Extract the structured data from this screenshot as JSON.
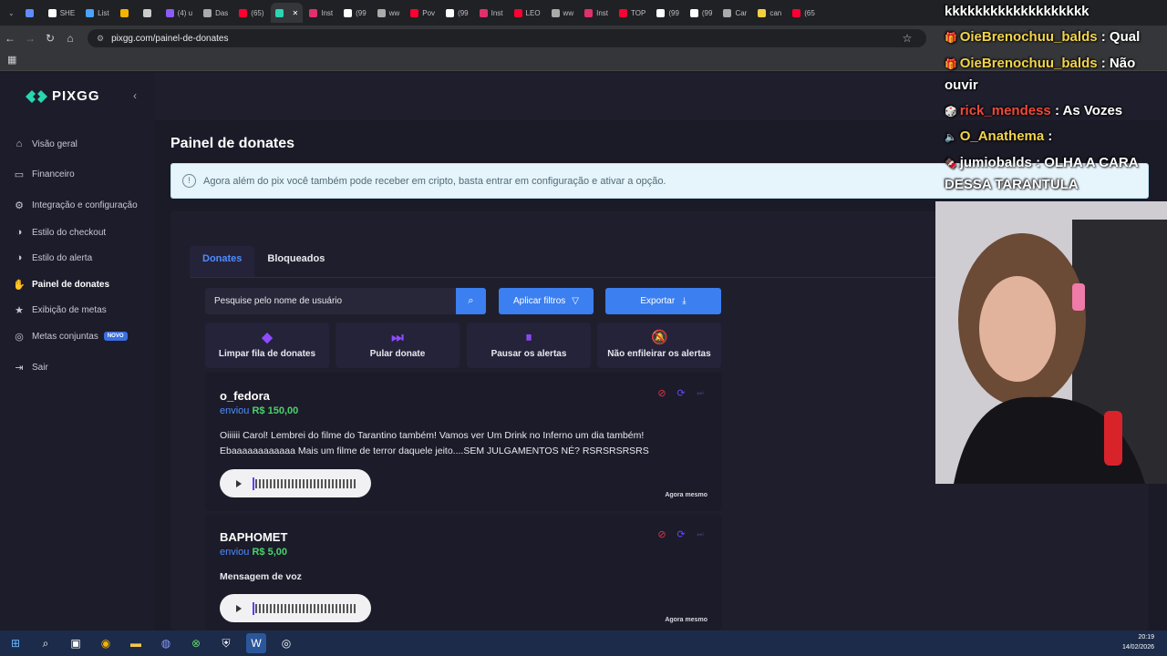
{
  "browser": {
    "tabs": [
      {
        "label": "",
        "color": "#5e8cff"
      },
      {
        "label": "SHE",
        "color": "#ffffff"
      },
      {
        "label": "List",
        "color": "#4aa3ff"
      },
      {
        "label": "",
        "color": "#f4b400"
      },
      {
        "label": "",
        "color": "#ccc"
      },
      {
        "label": "(4) u",
        "color": "#8b5cf6"
      },
      {
        "label": "Das",
        "color": "#aaa"
      },
      {
        "label": "(65)",
        "color": "#ff0033"
      },
      {
        "label": "",
        "color": "#29d6b0"
      },
      {
        "label": "Inst",
        "color": "#e1306c"
      },
      {
        "label": "(99",
        "color": "#fff"
      },
      {
        "label": "ww",
        "color": "#aaa"
      },
      {
        "label": "Pov",
        "color": "#ff0033"
      },
      {
        "label": "(99",
        "color": "#fff"
      },
      {
        "label": "Inst",
        "color": "#e1306c"
      },
      {
        "label": "LEO",
        "color": "#ff0033"
      },
      {
        "label": "ww",
        "color": "#aaa"
      },
      {
        "label": "Inst",
        "color": "#e1306c"
      },
      {
        "label": "TOP",
        "color": "#ff0033"
      },
      {
        "label": "(99",
        "color": "#fff"
      },
      {
        "label": "(99",
        "color": "#fff"
      },
      {
        "label": "Car",
        "color": "#aaa"
      },
      {
        "label": "can",
        "color": "#f4d03f"
      },
      {
        "label": "(65",
        "color": "#ff0033"
      }
    ],
    "url": "pixgg.com/painel-de-donates"
  },
  "sidebar": {
    "logo": "PIXGG",
    "items": [
      {
        "label": "Visão geral",
        "icon": "home-icon"
      },
      {
        "label": "Financeiro",
        "icon": "wallet-icon"
      },
      {
        "label": "Integração e configuração",
        "icon": "gear-icon"
      },
      {
        "label": "Estilo do checkout",
        "icon": "palette-icon"
      },
      {
        "label": "Estilo do alerta",
        "icon": "palette-icon"
      },
      {
        "label": "Painel de donates",
        "icon": "hand-coin-icon"
      },
      {
        "label": "Exibição de metas",
        "icon": "star-icon"
      },
      {
        "label": "Metas conjuntas",
        "icon": "target-icon",
        "badge": "NOVO"
      },
      {
        "label": "Sair",
        "icon": "logout-icon"
      }
    ]
  },
  "main": {
    "title": "Painel de donates",
    "info": "Agora além do pix você também pode receber em cripto, basta entrar em configuração e ativar a opção.",
    "tabs": [
      "Donates",
      "Bloqueados"
    ],
    "search_placeholder": "Pesquise pelo nome de usuário",
    "filters_label": "Aplicar filtros",
    "export_label": "Exportar",
    "actions": [
      "Limpar fila de donates",
      "Pular donate",
      "Pausar os alertas",
      "Não enfileirar os alertas"
    ],
    "donates": [
      {
        "user": "o_fedora",
        "sent_prefix": "enviou",
        "amount": "R$ 150,00",
        "message_lines": [
          "Oiiiiii Carol! Lembrei do filme do Tarantino também! Vamos ver Um Drink no Inferno um dia também!",
          "Ebaaaaaaaaaaaa Mais um filme de terror daquele jeito....SEM JULGAMENTOS NÉ? RSRSRSRSRS"
        ],
        "when": "Agora mesmo"
      },
      {
        "user": "BAPHOMET",
        "sent_prefix": "enviou",
        "amount": "R$ 5,00",
        "message_lines": [
          "Mensagem de voz"
        ],
        "when": "Agora mesmo"
      }
    ]
  },
  "overlay_chat": {
    "lines": [
      {
        "name": "",
        "text": "kkkkkkkkkkkkkkkkkkk"
      },
      {
        "name": "OieBrenochuu_balds",
        "text": ": Qual"
      },
      {
        "name": "OieBrenochuu_balds",
        "text": ": Não"
      },
      {
        "name": "",
        "text": "ouvir"
      },
      {
        "name": "rick_mendess",
        "text": ": As Vozes"
      },
      {
        "name": "O_Anathema",
        "text": ":"
      },
      {
        "name": "jumiobalds",
        "text": ": OLHA A CARA"
      },
      {
        "name": "",
        "text": "DESSA TARANTULA"
      }
    ]
  },
  "taskbar": {
    "time": "20:19",
    "date": "14/02/2026"
  },
  "colors": {
    "accent_blue": "#3b7ff0",
    "amount_green": "#4bd26b",
    "icon_purple": "#8f4bff",
    "sidebar_bg": "#1d1c2b"
  }
}
